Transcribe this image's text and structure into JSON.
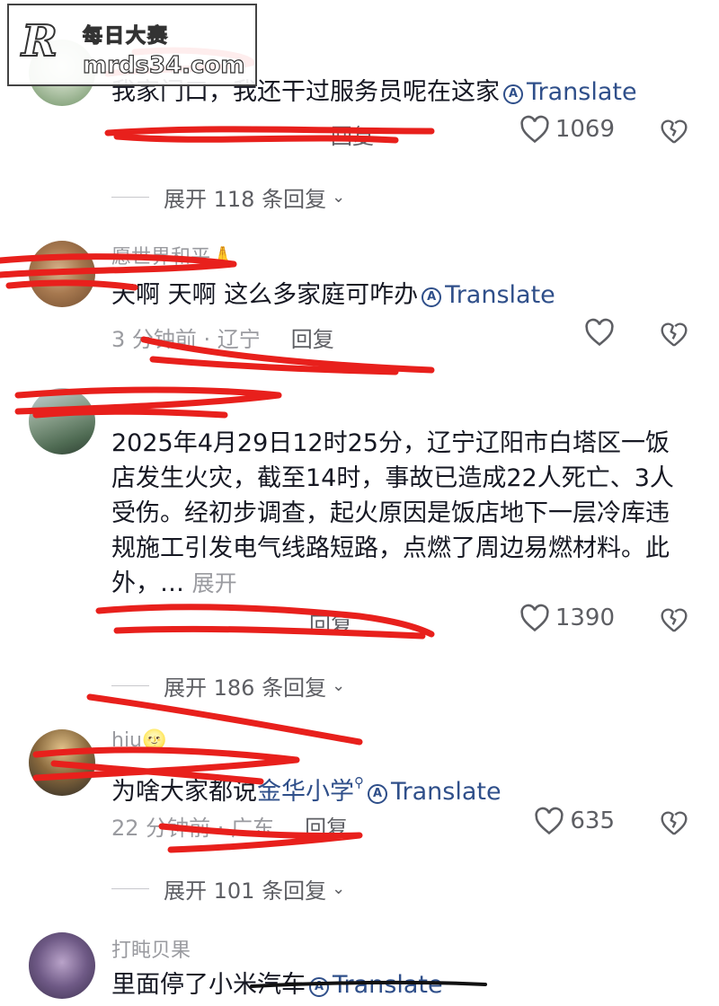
{
  "watermark": {
    "logo": "R",
    "brand": "每日大赛",
    "site": "mrds34.com"
  },
  "comments": [
    {
      "text": "我家门口，我还干过服务员呢在这家",
      "translate": "Translate",
      "reply": "回复",
      "likes": "1069",
      "expand": "展开 118 条回复"
    },
    {
      "author": "愿世界和平",
      "author_emoji": "🙏",
      "text": "天啊 天啊 这么多家庭可咋办",
      "translate": "Translate",
      "time": "3 分钟前 · 辽宁",
      "reply": "回复"
    },
    {
      "text": "2025年4月29日12时25分，辽宁辽阳市白塔区一饭店发生火灾，截至14时，事故已造成22人死亡、3人受伤。经初步调查，起火原因是饭店地下一层冷库违规施工引发电气线路短路，点燃了周边易燃材料。此外，…",
      "expand_text": "展开",
      "reply": "回复",
      "likes": "1390",
      "expand": "展开 186 条回复"
    },
    {
      "author": "hiu",
      "author_emoji": "🌝",
      "text_prefix": "为啥大家都说",
      "keyword": "金华小学",
      "translate": "Translate",
      "time": "22 分钟前 · 广东",
      "reply": "回复",
      "likes": "635",
      "expand": "展开 101 条回复"
    },
    {
      "author": "打盹贝果",
      "text": "里面停了小米汽车",
      "translate": "Translate"
    }
  ]
}
